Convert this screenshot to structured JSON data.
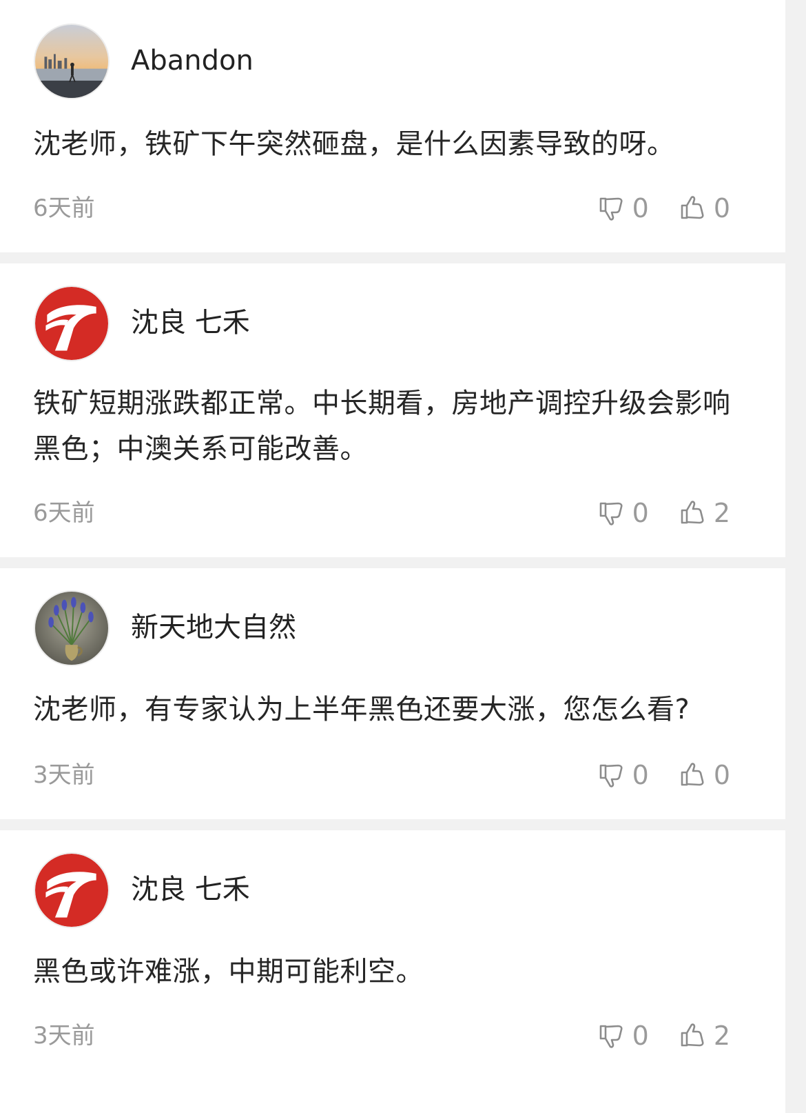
{
  "comments": [
    {
      "username": "Abandon",
      "avatar": "photo-avatar-city-sunset",
      "content": "沈老师，铁矿下午突然砸盘，是什么因素导致的呀。",
      "time": "6天前",
      "dislikes": "0",
      "likes": "0"
    },
    {
      "username": "沈良 七禾",
      "avatar": "logo-avatar-red-seven",
      "content": "铁矿短期涨跌都正常。中长期看，房地产调控升级会影响黑色；中澳关系可能改善。",
      "time": "6天前",
      "dislikes": "0",
      "likes": "2"
    },
    {
      "username": "新天地大自然",
      "avatar": "photo-avatar-flowers-vase",
      "content": "沈老师，有专家认为上半年黑色还要大涨，您怎么看?",
      "time": "3天前",
      "dislikes": "0",
      "likes": "0"
    },
    {
      "username": "沈良 七禾",
      "avatar": "logo-avatar-red-seven",
      "content": "黑色或许难涨，中期可能利空。",
      "time": "3天前",
      "dislikes": "0",
      "likes": "2"
    }
  ],
  "icons": {
    "dislike": "thumbs-down-icon",
    "like": "thumbs-up-icon"
  },
  "colors": {
    "background": "#f1f1f1",
    "card": "#ffffff",
    "brand_red": "#d42b25",
    "muted_text": "#9a9a9a"
  }
}
